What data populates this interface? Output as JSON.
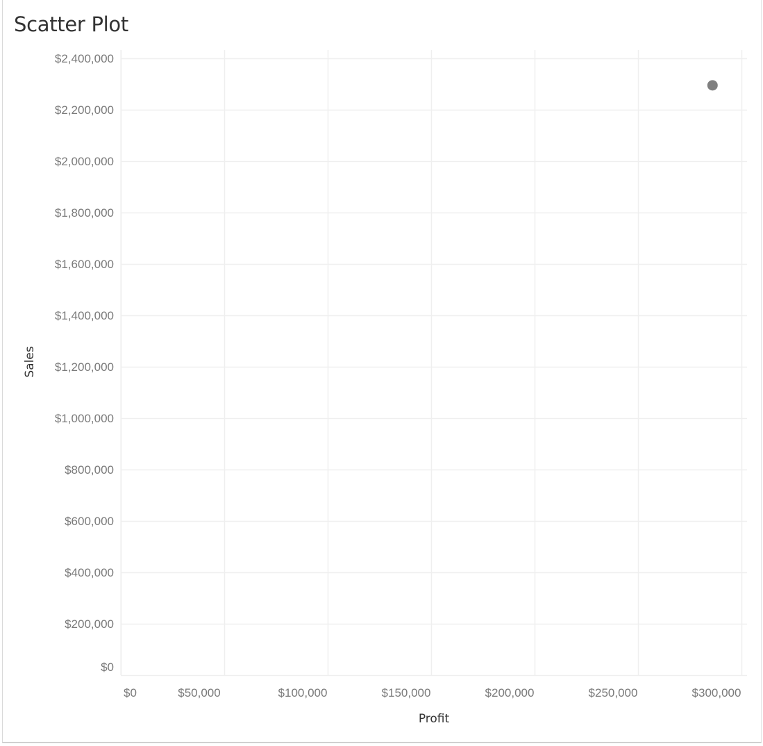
{
  "chart_data": {
    "type": "scatter",
    "title": "Scatter Plot",
    "xlabel": "Profit",
    "ylabel": "Sales",
    "xlim": [
      0,
      300000
    ],
    "ylim": [
      0,
      2400000
    ],
    "xticks": [
      0,
      50000,
      100000,
      150000,
      200000,
      250000,
      300000
    ],
    "xtick_labels": [
      "$0",
      "$50,000",
      "$100,000",
      "$150,000",
      "$200,000",
      "$250,000",
      "$300,000"
    ],
    "yticks": [
      0,
      200000,
      400000,
      600000,
      800000,
      1000000,
      1200000,
      1400000,
      1600000,
      1800000,
      2000000,
      2200000,
      2400000
    ],
    "ytick_labels": [
      "$0",
      "$200,000",
      "$400,000",
      "$600,000",
      "$800,000",
      "$1,000,000",
      "$1,200,000",
      "$1,400,000",
      "$1,600,000",
      "$1,800,000",
      "$2,000,000",
      "$2,200,000",
      "$2,400,000"
    ],
    "grid": true,
    "points": [
      {
        "x": 286000,
        "y": 2295000
      }
    ],
    "marker_color": "#7f7f7f",
    "grid_color": "#efefef"
  }
}
